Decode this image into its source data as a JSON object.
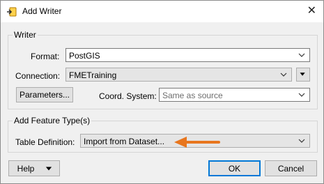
{
  "window": {
    "title": "Add Writer",
    "close_glyph": "✕"
  },
  "writer_group": {
    "legend": "Writer",
    "format_label": "Format:",
    "format_value": "PostGIS",
    "connection_label": "Connection:",
    "connection_value": "FMETraining",
    "parameters_button": "Parameters...",
    "coord_label": "Coord. System:",
    "coord_placeholder": "Same as source"
  },
  "feature_group": {
    "legend": "Add Feature Type(s)",
    "table_def_label": "Table Definition:",
    "table_def_value": "Import from Dataset..."
  },
  "footer": {
    "help_label": "Help",
    "ok_label": "OK",
    "cancel_label": "Cancel"
  },
  "colors": {
    "annotation_arrow": "#e8761e",
    "accent": "#0078d7"
  },
  "icons": [
    "add-writer-icon",
    "close-icon",
    "chevron-down-icon",
    "menu-triangle-icon",
    "annotation-arrow-icon"
  ]
}
